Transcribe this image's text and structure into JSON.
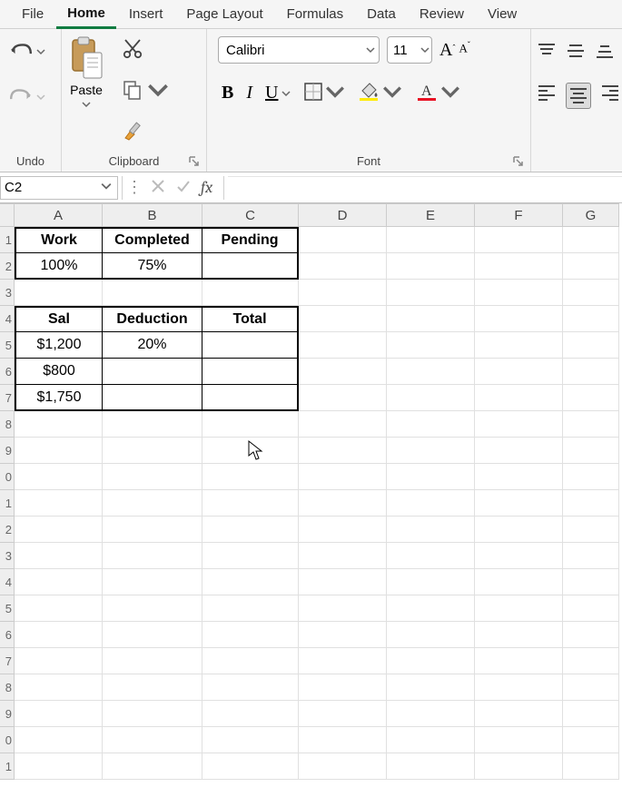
{
  "menu": {
    "file": "File",
    "home": "Home",
    "insert": "Insert",
    "page_layout": "Page Layout",
    "formulas": "Formulas",
    "data": "Data",
    "review": "Review",
    "view": "View"
  },
  "ribbon": {
    "undo_label": "Undo",
    "clipboard_label": "Clipboard",
    "paste_label": "Paste",
    "font_label": "Font",
    "font_name": "Calibri",
    "font_size": "11",
    "bold": "B",
    "italic": "I",
    "underline": "U",
    "letterA": "A"
  },
  "formula_bar": {
    "cell_ref": "C2",
    "fx": "fx",
    "formula": ""
  },
  "columns": [
    "A",
    "B",
    "C",
    "D",
    "E",
    "F",
    "G"
  ],
  "rows_visible": 21,
  "sheet": {
    "r1": {
      "A": "Work",
      "B": "Completed",
      "C": "Pending"
    },
    "r2": {
      "A": "100%",
      "B": "75%",
      "C": ""
    },
    "r4": {
      "A": "Sal",
      "B": "Deduction",
      "C": "Total"
    },
    "r5": {
      "A": "$1,200",
      "B": "20%",
      "C": ""
    },
    "r6": {
      "A": "$800",
      "B": "",
      "C": ""
    },
    "r7": {
      "A": "$1,750",
      "B": "",
      "C": ""
    }
  }
}
